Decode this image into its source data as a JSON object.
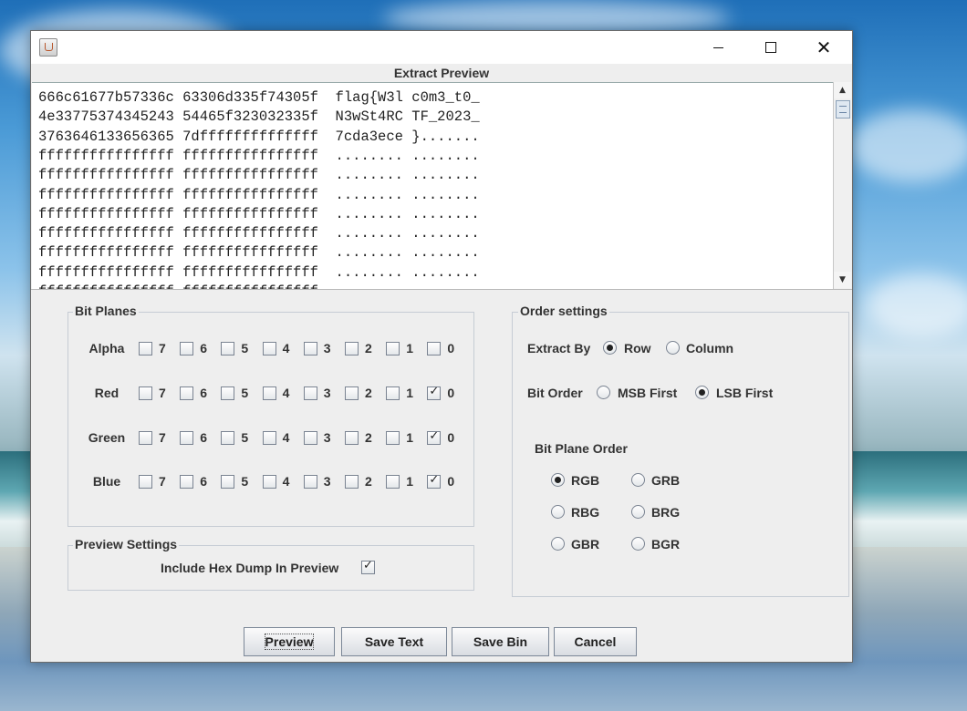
{
  "window": {
    "title": "",
    "preview_title": "Extract Preview"
  },
  "preview_lines": [
    "666c61677b57336c 63306d335f74305f  flag{W3l c0m3_t0_",
    "4e33775374345243 54465f323032335f  N3wSt4RC TF_2023_",
    "3763646133656365 7dffffffffffffff  7cda3ece }.......",
    "ffffffffffffffff ffffffffffffffff  ........ ........",
    "ffffffffffffffff ffffffffffffffff  ........ ........",
    "ffffffffffffffff ffffffffffffffff  ........ ........",
    "ffffffffffffffff ffffffffffffffff  ........ ........",
    "ffffffffffffffff ffffffffffffffff  ........ ........",
    "ffffffffffffffff ffffffffffffffff  ........ ........",
    "ffffffffffffffff ffffffffffffffff  ........ ........",
    "ffffffffffffffff ffffffffffffffff  ........ ........"
  ],
  "bit_planes": {
    "title": "Bit Planes",
    "bits": [
      "7",
      "6",
      "5",
      "4",
      "3",
      "2",
      "1",
      "0"
    ],
    "rows": [
      {
        "label": "Alpha",
        "checked": [
          false,
          false,
          false,
          false,
          false,
          false,
          false,
          false
        ]
      },
      {
        "label": "Red",
        "checked": [
          false,
          false,
          false,
          false,
          false,
          false,
          false,
          true
        ]
      },
      {
        "label": "Green",
        "checked": [
          false,
          false,
          false,
          false,
          false,
          false,
          false,
          true
        ]
      },
      {
        "label": "Blue",
        "checked": [
          false,
          false,
          false,
          false,
          false,
          false,
          false,
          true
        ]
      }
    ]
  },
  "preview_settings": {
    "title": "Preview Settings",
    "include_hex_label": "Include Hex Dump In Preview",
    "include_hex_checked": true
  },
  "order_settings": {
    "title": "Order settings",
    "extract_by_label": "Extract By",
    "extract_row": "Row",
    "extract_column": "Column",
    "extract_selected": "Row",
    "bit_order_label": "Bit Order",
    "msb_first": "MSB First",
    "lsb_first": "LSB First",
    "bit_order_selected": "LSB First",
    "bit_plane_order_label": "Bit Plane Order",
    "plane_orders": [
      "RGB",
      "GRB",
      "RBG",
      "BRG",
      "GBR",
      "BGR"
    ],
    "plane_order_selected": "RGB"
  },
  "buttons": {
    "preview": "Preview",
    "save_text": "Save Text",
    "save_bin": "Save Bin",
    "cancel": "Cancel"
  }
}
